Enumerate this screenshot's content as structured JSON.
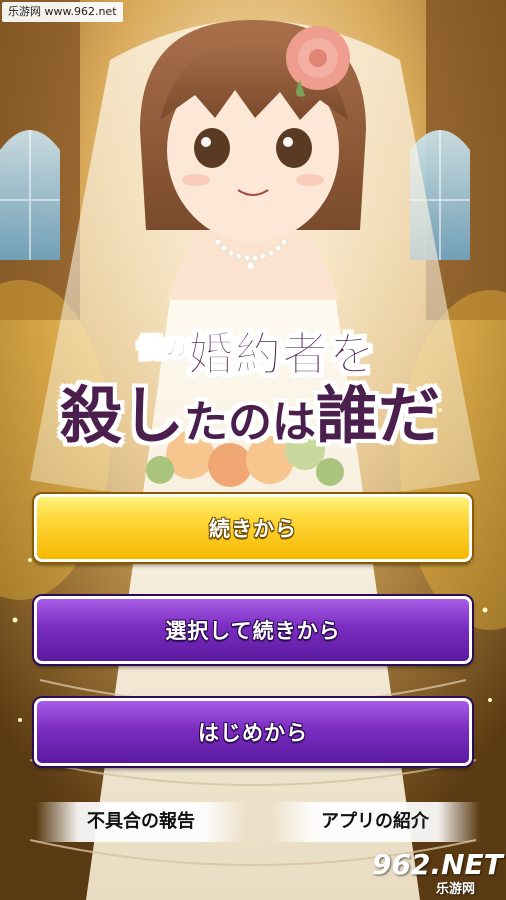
{
  "watermark_top": "乐游网 www.962.net",
  "title": {
    "line1_small": "僕の",
    "line1_main": "婚約者を",
    "line2_a": "殺し",
    "line2_b": "たのは",
    "line2_c": "誰だ"
  },
  "menu": {
    "continue_label": "続きから",
    "select_continue_label": "選択して続きから",
    "new_game_label": "はじめから"
  },
  "footer": {
    "bug_report_label": "不具合の報告",
    "app_intro_label": "アプリの紹介"
  },
  "watermark_bottom": {
    "main": "962.NET",
    "sub": "乐游网"
  },
  "colors": {
    "title_text": "#4b1f4d",
    "button_yellow": "#ffd83a",
    "button_purple": "#7b2dc2"
  }
}
